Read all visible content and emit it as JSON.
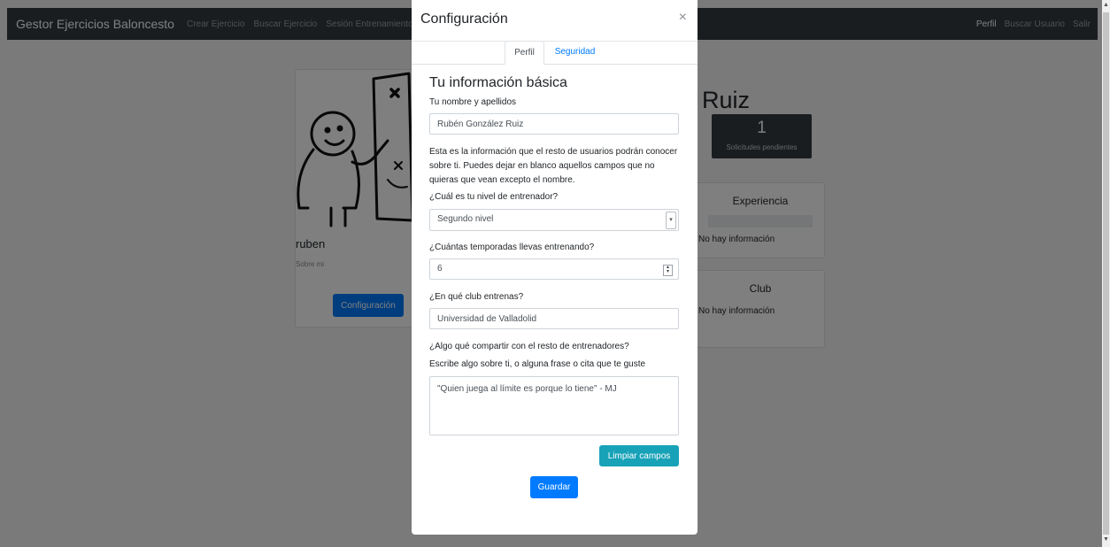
{
  "navbar": {
    "brand": "Gestor Ejercicios Baloncesto",
    "left_links": [
      "Crear Ejercicio",
      "Buscar Ejercicio",
      "Sesión Entrenamiento"
    ],
    "right_links": [
      "Perfil",
      "Buscar Usuario",
      "Salir"
    ]
  },
  "background": {
    "username": "ruben",
    "about_label": "Sobre mi",
    "config_button": "Configuración",
    "profile_name_fragment": "Ruiz",
    "pending": {
      "count": "1",
      "label": "Solicitudes pendientes"
    },
    "experience": {
      "title": "Experiencia",
      "empty": "No hay información"
    },
    "club": {
      "title": "Club",
      "empty": "No hay información"
    }
  },
  "modal": {
    "title": "Configuración",
    "close_symbol": "×",
    "tabs": [
      {
        "label": "Perfil",
        "active": true
      },
      {
        "label": "Seguridad",
        "active": false
      }
    ],
    "section_title": "Tu información básica",
    "name_label": "Tu nombre y apellidos",
    "name_value": "Rubén González Ruiz",
    "help_text": "Esta es la información que el resto de usuarios podrán conocer sobre ti. Puedes dejar en blanco aquellos campos que no quieras que vean excepto el nombre.",
    "level_label": "¿Cuál es tu nivel de entrenador?",
    "level_value": "Segundo nivel",
    "seasons_label": "¿Cuántas temporadas llevas entrenando?",
    "seasons_value": "6",
    "club_label": "¿En qué club entrenas?",
    "club_value": "Universidad de Valladolid",
    "share_label": "¿Algo qué compartir con el resto de entrenadores?",
    "share_hint": "Escribe algo sobre ti, o alguna frase o cita que te guste",
    "share_value": "\"Quien juega al límite es porque lo tiene\" - MJ",
    "clear_button": "Limpiar campos",
    "save_button": "Guardar"
  },
  "colors": {
    "navbar": "#343a40",
    "primary": "#007bff",
    "info": "#17a2b8",
    "link": "#007bff"
  },
  "icons": {
    "close": "close-icon",
    "select": "chevron-down-icon",
    "spinner": "number-spinner-icon"
  }
}
